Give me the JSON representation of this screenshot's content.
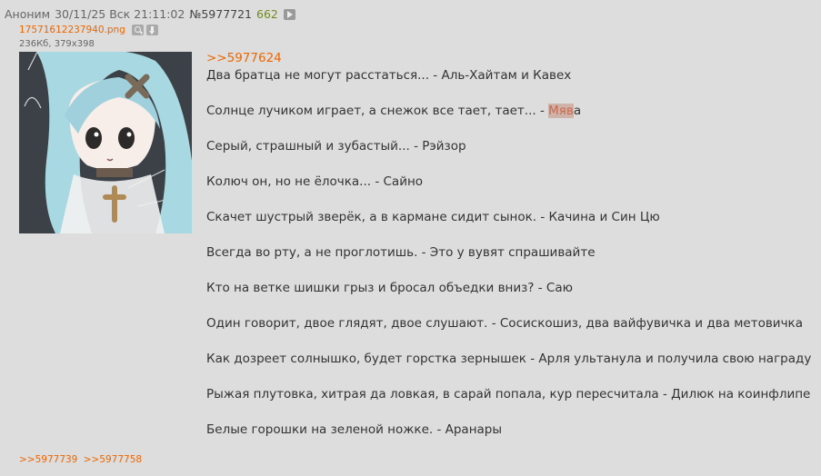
{
  "header": {
    "name": "Аноним",
    "datetime": "30/11/25 Вск 21:11:02",
    "post_number": "№5977721",
    "reply_count": "662"
  },
  "file": {
    "name": "17571612237940.png",
    "meta": "236Кб, 379x398"
  },
  "post": {
    "reply_to": ">>5977624",
    "lines": [
      "Два братца не могут расстаться... - Аль-Хайтам и Кавех",
      "Солнце лучиком играет, а снежок все тает, тает... - ",
      "Серый, страшный и зубастый... - Рэйзор",
      "Колюч он, но не ёлочка... - Сайно",
      "Скачет шустрый зверёк, а в кармане сидит сынок. - Качина и Син Цю",
      "Всегда во рту, а не проглотишь. - Это у вувят спрашивайте",
      "Кто на ветке шишки грыз и бросал объедки вниз? - Саю",
      "Один говорит, двое глядят, двое слушают. - Сосискошиз, два вайфувичка и два метовичка",
      "Как дозреет солнышко, будет горстка зернышек - Арля ультанула и получила свою награду",
      "Рыжая плутовка, хитрая да ловкая, в сарай попала, кур пересчитала - Дилюк на коинфлипе",
      "Белые горошки на зеленой ножке. - Аранары"
    ],
    "spoiler_text": "Мяв",
    "spoiler_tail": "а"
  },
  "backlinks": [
    ">>5977739",
    ">>5977758"
  ],
  "icons": [
    "play-icon",
    "search-icon",
    "download-icon"
  ],
  "colors": {
    "background": "#dddddd",
    "link": "#ee6600",
    "reply_count": "#6f8c1a",
    "spoiler_bg": "#cfb3a8"
  }
}
